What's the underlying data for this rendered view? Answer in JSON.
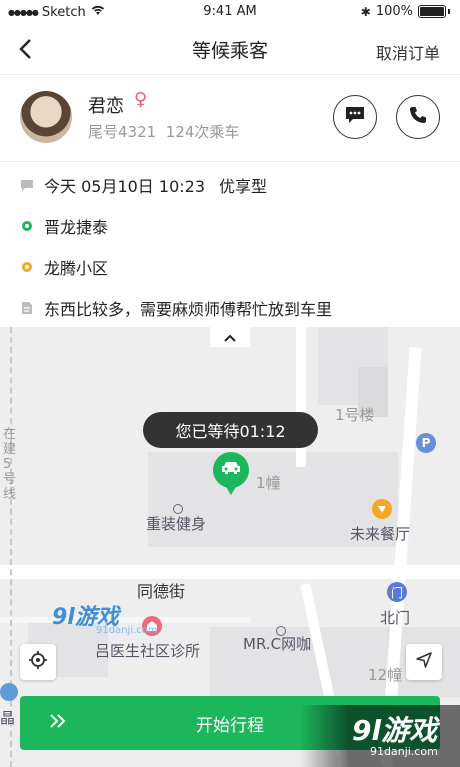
{
  "status_bar": {
    "carrier": "Sketch",
    "time": "9:41 AM",
    "battery": "100%"
  },
  "nav": {
    "title": "等候乘客",
    "cancel_label": "取消订单"
  },
  "passenger": {
    "name": "君恋",
    "gender_symbol": "♀",
    "tail_number": "尾号4321",
    "ride_count": "124次乘车"
  },
  "order": {
    "time_text": "今天 05月10日 10:23",
    "car_type": "优享型",
    "pickup": "晋龙捷泰",
    "dropoff": "龙腾小区",
    "note": "东西比较多，需要麻烦师傅帮忙放到车里"
  },
  "map": {
    "wait_text": "您已等待01:12",
    "labels": {
      "building1": "1号楼",
      "building_1zhuang": "1幢",
      "gym": "重装健身",
      "restaurant": "未来餐厅",
      "street": "同德街",
      "north_gate": "北门",
      "clinic": "吕医生社区诊所",
      "cafe": "MR.C网咖",
      "building12": "12幢",
      "left_vertical": "在建5号线",
      "left_edge": "晶",
      "watermark_site": "91danji.com"
    }
  },
  "start_button_label": "开始行程",
  "watermark": {
    "logo_text": "9l游戏",
    "url": "91danji.com"
  },
  "colors": {
    "green": "#1cb65c",
    "orange": "#f5a623",
    "female": "#e6607e"
  }
}
